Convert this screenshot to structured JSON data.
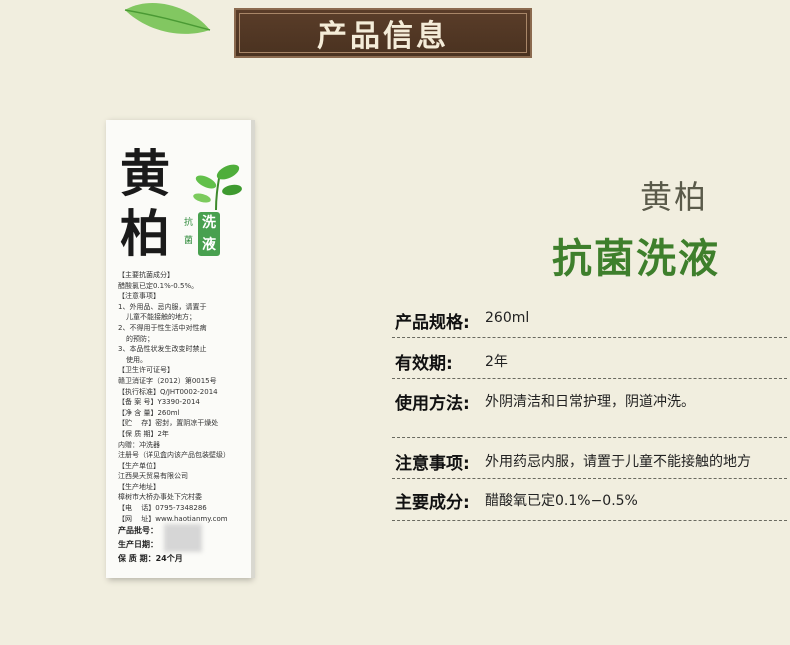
{
  "banner": {
    "title": "产品信息"
  },
  "product_box": {
    "char1": "黄",
    "char2": "柏",
    "tag_small": "抗菌",
    "tag_main": "洗液",
    "lines": [
      "【主要抗菌成分】",
      "醋酸氯已定0.1%-0.5%。",
      "【注意事项】",
      "1、外用品、忌内服，请置于",
      "儿童不能接触的地方；",
      "2、不得用于性生活中对性病",
      "的预防；",
      "3、本品性状发生改变时禁止",
      "使用。",
      "【卫生许可证号】",
      "赣卫消证字（2012）第0015号",
      "【执行标准】Q/JHT0002-2014",
      "【备 案 号】Y3390-2014",
      "【净 含 量】260ml",
      "【贮　 存】密封，置阴凉干燥处",
      "【保 质 期】2年",
      "内赠：冲洗器",
      "注册号（详见盒内该产品包装壁级）",
      "【生产单位】",
      "江西昊天贸易有限公司",
      "【生产地址】",
      "樟树市大桥办事处下宂村委",
      "【电　 话】0795-7348286",
      "【网　 址】www.haotianmy.com"
    ],
    "bottom": [
      "产品批号：",
      "生产日期：",
      "保 质 期：24个月"
    ]
  },
  "heading": {
    "name": "黄柏",
    "subtitle": "抗菌洗液"
  },
  "specs": [
    {
      "label": "产品规格:",
      "value": "260ml"
    },
    {
      "label": "有效期:",
      "value": "2年"
    },
    {
      "label": "使用方法:",
      "value": "外阴清洁和日常护理，阴道冲洗。"
    },
    {
      "label": "注意事项:",
      "value": "外用药忌内服，请置于儿童不能接触的地方"
    },
    {
      "label": "主要成分:",
      "value": "醋酸氧已定0.1%−0.5%"
    }
  ],
  "colors": {
    "background": "#f1eedf",
    "banner": "#4a3220",
    "accent_green": "#3e7f2c"
  },
  "icons": {
    "leaf_decoration": "leaf-icon",
    "box_sprout": "sprout-icon"
  }
}
